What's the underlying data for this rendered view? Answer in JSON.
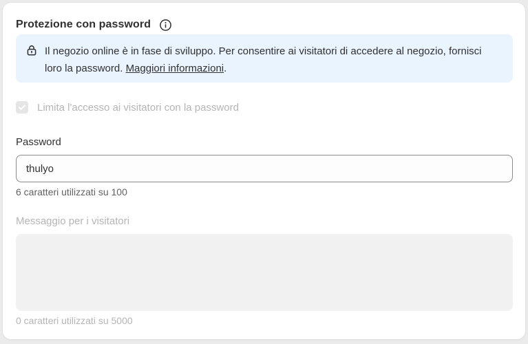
{
  "section": {
    "title": "Protezione con password",
    "info_icon": "info-circle-icon"
  },
  "banner": {
    "icon": "lock-icon",
    "text": "Il negozio online è in fase di sviluppo. Per consentire ai visitatori di accedere al negozio, fornisci loro la password. ",
    "link_label": "Maggiori informazioni",
    "trailing": ".",
    "background_color": "#eaf4ff"
  },
  "restrict_access": {
    "label": "Limita l'accesso ai visitatori con la password",
    "checked": true,
    "disabled": true
  },
  "password": {
    "label": "Password",
    "value": "thulyo",
    "help_text": "6 caratteri utilizzati su 100"
  },
  "visitor_message": {
    "label": "Messaggio per i visitatori",
    "value": "",
    "help_text": "0 caratteri utilizzati su 5000",
    "disabled": true
  }
}
